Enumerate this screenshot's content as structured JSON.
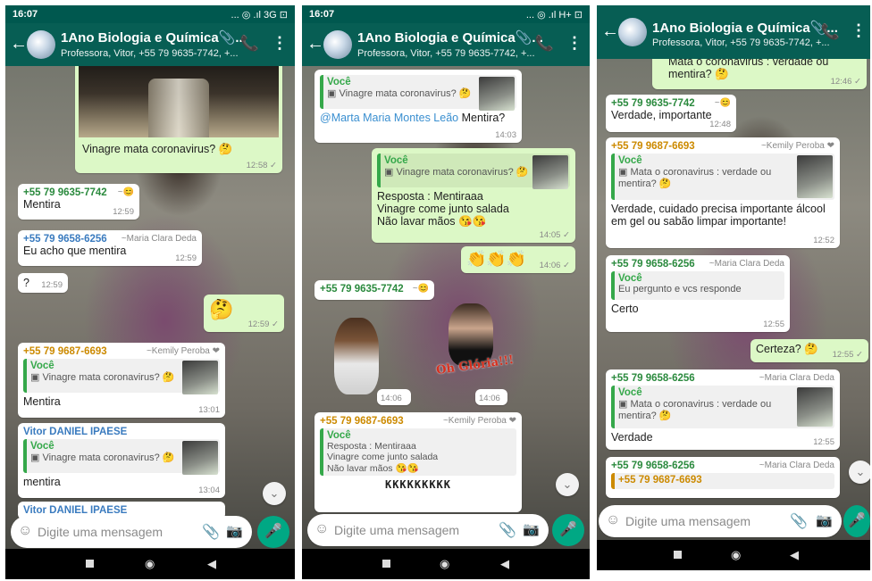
{
  "phones": [
    {
      "status_time": "16:07",
      "status_icons": "... ◎ .ıl 3G ⊡",
      "title": "1Ano Biologia e Química📎...",
      "subtitle": "Professora, Vitor, +55 79 9635-7742, +...",
      "input_placeholder": "Digite uma mensagem",
      "messages": {
        "m1_text": "Vinagre mata coronavirus? 🤔",
        "m1_time": "12:58 ✓",
        "m2_sender": "+55 79 9635-7742",
        "m2_alias": "~😊",
        "m2_text": "Mentira",
        "m2_time": "12:59",
        "m3_sender": "+55 79 9658-6256",
        "m3_alias": "~Maria Clara Deda",
        "m3_text": "Eu acho que mentira",
        "m3_time": "12:59",
        "m4_text": "?",
        "m4_time": "12:59",
        "m5_text": "🤔",
        "m5_time": "12:59 ✓",
        "m6_sender": "+55 79 9687-6693",
        "m6_alias": "~Kemily Peroba ❤",
        "m6_quote_author": "Você",
        "m6_quote_text": "▣ Vinagre mata coronavirus? 🤔",
        "m6_text": "Mentira",
        "m6_time": "13:01",
        "m7_sender": "Vitor DANIEL IPAESE",
        "m7_quote_author": "Você",
        "m7_quote_text": "▣ Vinagre mata coronavirus? 🤔",
        "m7_text": "mentira",
        "m7_time": "13:04",
        "m8_sender": "Vitor DANIEL IPAESE"
      }
    },
    {
      "status_time": "16:07",
      "status_icons": "... ◎ .ıl H+ ⊡",
      "title": "1Ano Biologia e Química📎...",
      "subtitle": "Professora, Vitor, +55 79 9635-7742, +...",
      "input_placeholder": "Digite uma mensagem",
      "messages": {
        "m1_quote_author": "Você",
        "m1_quote_text": "▣ Vinagre mata coronavirus? 🤔",
        "m1_mention": "@Marta Maria Montes Leão",
        "m1_text": " Mentira?",
        "m1_time": "14:03",
        "m2_quote_author": "Você",
        "m2_quote_text": "▣ Vinagre mata coronavirus? 🤔",
        "m2_line1": "Resposta : Mentiraaa",
        "m2_line2": "Vinagre come junto salada",
        "m2_line3": "Não lavar mãos 😘😘",
        "m2_time": "14:05 ✓",
        "m3_text": "👏👏👏",
        "m3_time": "14:06 ✓",
        "m4_sender": "+55 79 9635-7742",
        "m4_alias": "~😊",
        "m4_time": "14:06",
        "m5_caption": "Oh Glória!!!",
        "m5_time": "14:06",
        "m6_sender": "+55 79 9687-6693",
        "m6_alias": "~Kemily Peroba ❤",
        "m6_quote_author": "Você",
        "m6_quote_l1": "Resposta : Mentiraaa",
        "m6_quote_l2": "Vinagre come junto salada",
        "m6_quote_l3": "Não lavar mãos 😘😘",
        "m6_text": "KKKKKKKKK"
      }
    },
    {
      "title": "1Ano Biologia e Química📎...",
      "subtitle": "Professora, Vitor, +55 79 9635-7742, +...",
      "input_placeholder": "Digite uma mensagem",
      "messages": {
        "m0_text": "Mata o coronavirus : verdade ou mentira? 🤔",
        "m0_time": "12:46 ✓",
        "m1_sender": "+55 79 9635-7742",
        "m1_alias": "~😊",
        "m1_text": "Verdade, importante",
        "m1_time": "12:48",
        "m2_sender": "+55 79 9687-6693",
        "m2_alias": "~Kemily Peroba ❤",
        "m2_quote_author": "Você",
        "m2_quote_text": "▣ Mata o coronavirus : verdade ou mentira? 🤔",
        "m2_text": "Verdade, cuidado precisa importante álcool em gel ou sabão limpar importante!",
        "m2_time": "12:52",
        "m3_sender": "+55 79 9658-6256",
        "m3_alias": "~Maria Clara Deda",
        "m3_quote_author": "Você",
        "m3_quote_text": "Eu pergunto e vcs responde",
        "m3_text": "Certo",
        "m3_time": "12:55",
        "m4_text": "Certeza? 🤔",
        "m4_time": "12:55 ✓",
        "m5_sender": "+55 79 9658-6256",
        "m5_alias": "~Maria Clara Deda",
        "m5_quote_author": "Você",
        "m5_quote_text": "▣ Mata o coronavirus : verdade ou mentira? 🤔",
        "m5_text": "Verdade",
        "m5_time": "12:55",
        "m6_sender": "+55 79 9658-6256",
        "m6_alias": "~Maria Clara Deda",
        "m6_quote": "+55 79 9687-6693"
      }
    }
  ]
}
